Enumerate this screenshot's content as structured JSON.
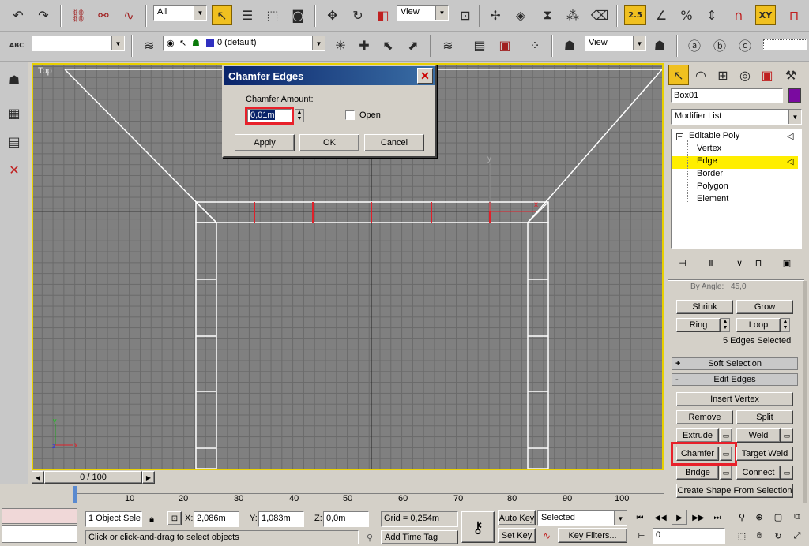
{
  "toolbar_main": {
    "selection_filter": "All",
    "ref_coord": "View",
    "snap_label": "2.5",
    "xy_label": "XY"
  },
  "toolbar_second": {
    "named_selection": "",
    "layer": "0 (default)",
    "view_combo": "View",
    "abc_label": "ABC"
  },
  "viewport": {
    "label": "Top",
    "axis_y": "y",
    "axis_x": "x",
    "gizmo_y": "y",
    "gizmo_x": "x",
    "gizmo_z": "z"
  },
  "dialog": {
    "title": "Chamfer Edges",
    "amount_label": "Chamfer Amount:",
    "amount_value": "0,01m",
    "open_label": "Open",
    "apply": "Apply",
    "ok": "OK",
    "cancel": "Cancel",
    "close_glyph": "✕"
  },
  "command_panel": {
    "object_name": "Box01",
    "object_color": "#7a0aa0",
    "modifier_list": "Modifier List",
    "stack": {
      "root": "Editable Poly",
      "items": [
        "Vertex",
        "Edge",
        "Border",
        "Polygon",
        "Element"
      ],
      "selected": "Edge"
    },
    "by_angle_label": "By Angle:",
    "by_angle_value": "45,0",
    "shrink": "Shrink",
    "grow": "Grow",
    "ring": "Ring",
    "loop": "Loop",
    "selection_info": "5 Edges Selected",
    "soft_selection": "Soft Selection",
    "edit_edges": "Edit Edges",
    "plus_sign": "+",
    "minus_sign": "-",
    "insert_vertex": "Insert Vertex",
    "remove": "Remove",
    "split": "Split",
    "extrude": "Extrude",
    "weld": "Weld",
    "chamfer": "Chamfer",
    "target_weld": "Target Weld",
    "bridge": "Bridge",
    "connect": "Connect",
    "create_shape": "Create Shape From Selection"
  },
  "timeline": {
    "frame": "0 / 100",
    "ticks": [
      "0",
      "10",
      "20",
      "30",
      "40",
      "50",
      "60",
      "70",
      "80",
      "90",
      "100"
    ]
  },
  "status": {
    "selection": "1 Object Sele",
    "x_label": "X:",
    "x_value": "2,086m",
    "y_label": "Y:",
    "y_value": "1,083m",
    "z_label": "Z:",
    "z_value": "0,0m",
    "grid": "Grid = 0,254m",
    "auto_key": "Auto Key",
    "set_key": "Set Key",
    "key_mode": "Selected",
    "key_filters": "Key Filters...",
    "prompt": "Click or click-and-drag to select objects",
    "add_time_tag": "Add Time Tag",
    "frame_value": "0"
  },
  "colors": {
    "viewport_bg": "#808080",
    "active_border": "#e8d000",
    "highlight": "#e8202a",
    "stack_selected": "#ffee00"
  }
}
